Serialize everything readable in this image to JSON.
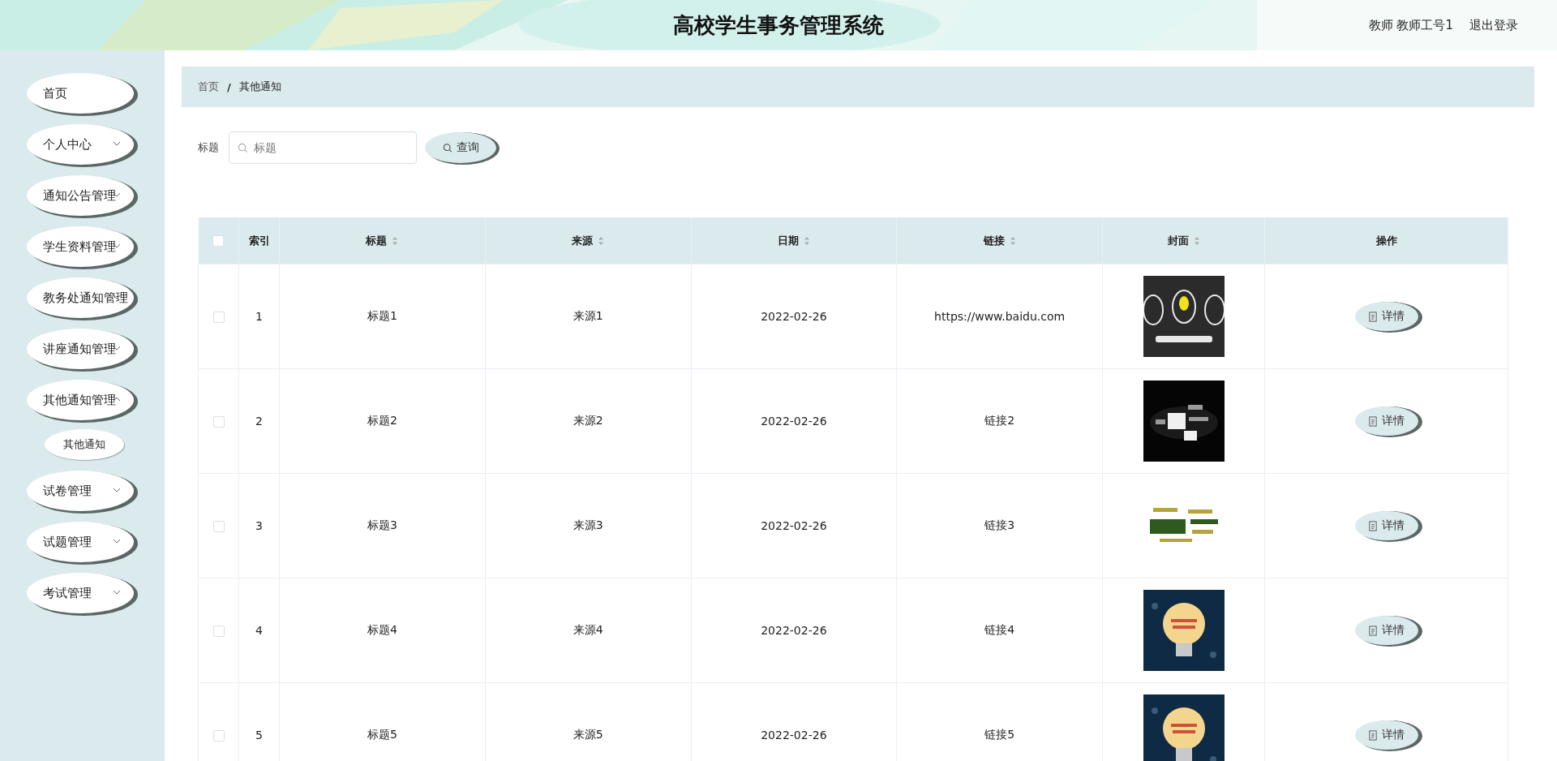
{
  "header": {
    "title": "高校学生事务管理系统",
    "user": "教师 教师工号1",
    "logout": "退出登录"
  },
  "sidebar": {
    "items": [
      {
        "label": "首页",
        "kind": "item"
      },
      {
        "label": "个人中心",
        "kind": "submenu",
        "expanded": false
      },
      {
        "label": "通知公告管理",
        "kind": "submenu",
        "expanded": false
      },
      {
        "label": "学生资料管理",
        "kind": "submenu",
        "expanded": false
      },
      {
        "label": "教务处通知管理",
        "kind": "submenu",
        "expanded": false
      },
      {
        "label": "讲座通知管理",
        "kind": "submenu",
        "expanded": false
      },
      {
        "label": "其他通知管理",
        "kind": "submenu",
        "expanded": true,
        "children": [
          {
            "label": "其他通知"
          }
        ]
      },
      {
        "label": "试卷管理",
        "kind": "submenu",
        "expanded": false
      },
      {
        "label": "试题管理",
        "kind": "submenu",
        "expanded": false
      },
      {
        "label": "考试管理",
        "kind": "submenu",
        "expanded": false
      }
    ]
  },
  "breadcrumb": {
    "items": [
      "首页",
      "其他通知"
    ],
    "separator": "/"
  },
  "search": {
    "label": "标题",
    "placeholder": "标题",
    "button": "查询"
  },
  "table": {
    "all_checked": false,
    "columns": [
      {
        "label": "索引",
        "sortable": false
      },
      {
        "label": "标题",
        "sortable": true
      },
      {
        "label": "来源",
        "sortable": true
      },
      {
        "label": "日期",
        "sortable": true
      },
      {
        "label": "链接",
        "sortable": true
      },
      {
        "label": "封面",
        "sortable": true
      },
      {
        "label": "操作",
        "sortable": false
      }
    ],
    "rows": [
      {
        "checked": false,
        "index": "1",
        "title": "标题1",
        "source": "来源1",
        "date": "2022-02-26",
        "link": "https://www.baidu.com",
        "action": "详情"
      },
      {
        "checked": false,
        "index": "2",
        "title": "标题2",
        "source": "来源2",
        "date": "2022-02-26",
        "link": "链接2",
        "action": "详情"
      },
      {
        "checked": false,
        "index": "3",
        "title": "标题3",
        "source": "来源3",
        "date": "2022-02-26",
        "link": "链接3",
        "action": "详情"
      },
      {
        "checked": false,
        "index": "4",
        "title": "标题4",
        "source": "来源4",
        "date": "2022-02-26",
        "link": "链接4",
        "action": "详情"
      },
      {
        "checked": false,
        "index": "5",
        "title": "标题5",
        "source": "来源5",
        "date": "2022-02-26",
        "link": "链接5",
        "action": "详情"
      }
    ]
  }
}
